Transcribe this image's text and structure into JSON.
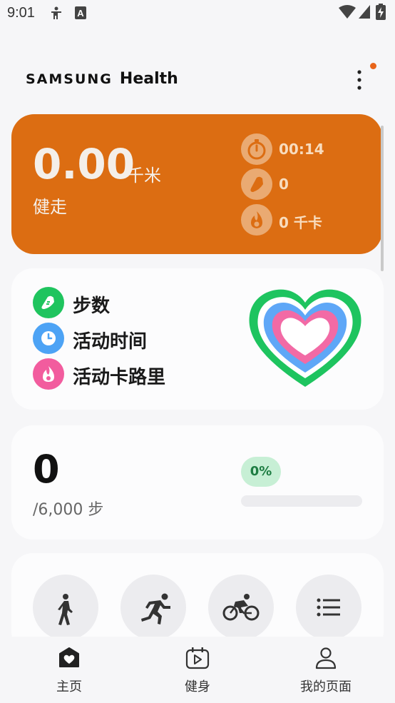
{
  "status_bar": {
    "time": "9:01",
    "icons": [
      "accessibility-icon",
      "keyboard-a-icon",
      "wifi-icon",
      "signal-icon",
      "battery-icon"
    ]
  },
  "header": {
    "brand": "SAMSUNG",
    "app_name": "Health",
    "menu_icon": "more-vertical-icon",
    "notification_color": "#e8641a"
  },
  "exercise": {
    "distance": "0.00",
    "distance_unit": "千米",
    "type": "健走",
    "accent": "#dc6d12",
    "stats": [
      {
        "icon": "stopwatch-icon",
        "value": "00:14"
      },
      {
        "icon": "shoe-icon",
        "value": "0"
      },
      {
        "icon": "flame-icon",
        "value": "0 千卡"
      }
    ]
  },
  "activity": {
    "items": [
      {
        "icon": "shoe-icon",
        "label": "步数",
        "color": "#1fc45e"
      },
      {
        "icon": "clock-icon",
        "label": "活动时间",
        "color": "#4da3f5"
      },
      {
        "icon": "flame-icon",
        "label": "活动卡路里",
        "color": "#f25c9e"
      }
    ]
  },
  "steps": {
    "count": "0",
    "target": "/6,000 步",
    "percent_label": "0%",
    "progress": 0
  },
  "quick_actions": [
    {
      "icon": "walking-icon"
    },
    {
      "icon": "running-icon"
    },
    {
      "icon": "cycling-icon"
    },
    {
      "icon": "list-icon"
    }
  ],
  "bottom_nav": {
    "items": [
      {
        "icon": "home-heart-icon",
        "label": "主页",
        "active": true
      },
      {
        "icon": "calendar-play-icon",
        "label": "健身",
        "active": false
      },
      {
        "icon": "person-icon",
        "label": "我的页面",
        "active": false
      }
    ]
  }
}
